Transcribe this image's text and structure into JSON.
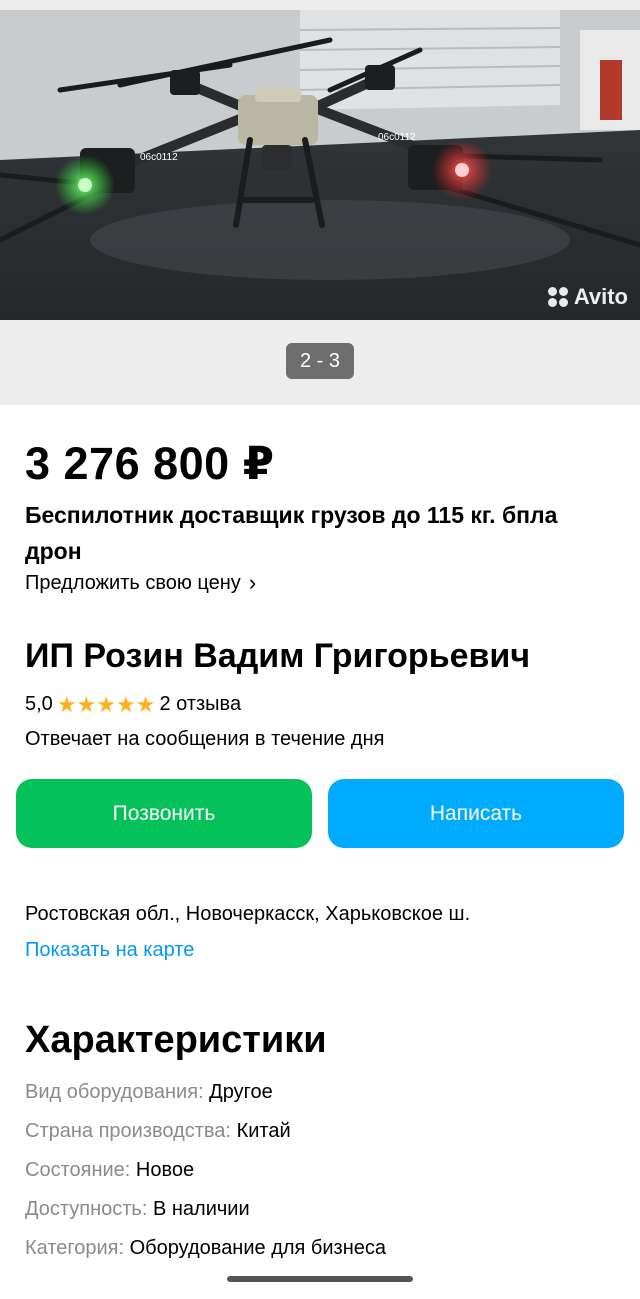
{
  "gallery": {
    "counter": "2 - 3",
    "watermark": "Avito",
    "drone_tag": "06c0112"
  },
  "listing": {
    "price": "3 276 800 ₽",
    "title": "Беспилотник доставщик грузов до 115 кг. бпла дрон",
    "offer_label": "Предложить свою цену",
    "offer_chevron": "›"
  },
  "seller": {
    "name": "ИП Розин Вадим Григорьевич",
    "rating": "5,0",
    "stars": 5,
    "reviews": "2 отзыва",
    "reply_time": "Отвечает на сообщения в течение дня"
  },
  "actions": {
    "call_label": "Позвонить",
    "write_label": "Написать"
  },
  "location": {
    "address": "Ростовская обл., Новочеркасск, Харьковское ш.",
    "map_link": "Показать на карте"
  },
  "specs": {
    "title": "Характеристики",
    "rows": [
      {
        "key": "Вид оборудования:",
        "value": "Другое"
      },
      {
        "key": "Страна производства:",
        "value": "Китай"
      },
      {
        "key": "Состояние:",
        "value": "Новое"
      },
      {
        "key": "Доступность:",
        "value": "В наличии"
      },
      {
        "key": "Категория:",
        "value": "Оборудование для бизнеса"
      }
    ]
  },
  "colors": {
    "call_button": "#05c159",
    "write_button": "#00aaff",
    "link": "#0099f7",
    "star": "#ffb021"
  }
}
